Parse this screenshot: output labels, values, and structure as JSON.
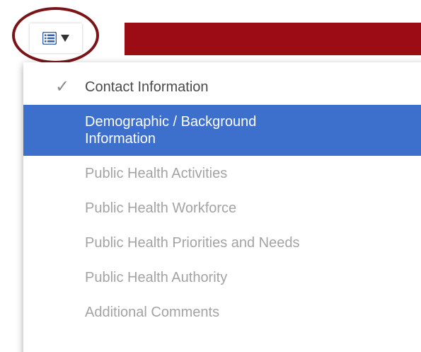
{
  "toolbar": {
    "toc_icon": "list-icon",
    "caret_icon": "caret-down-icon"
  },
  "colors": {
    "header_bar": "#9b0c14",
    "highlight_ring": "#7a1419",
    "active_item_bg": "#3d6fcc",
    "active_item_text": "#ffffff",
    "visited_item_text": "#4a4a4a",
    "inactive_item_text": "#a3a3a3"
  },
  "menu": {
    "items": [
      {
        "label": "Contact Information",
        "state": "visited",
        "icon": "checkmark-icon",
        "icon_glyph": "✓"
      },
      {
        "label": "Demographic / Background Information",
        "state": "active"
      },
      {
        "label": "Public Health Activities",
        "state": "disabled"
      },
      {
        "label": "Public Health Workforce",
        "state": "disabled"
      },
      {
        "label": "Public Health Priorities and Needs",
        "state": "disabled"
      },
      {
        "label": "Public Health Authority",
        "state": "disabled"
      },
      {
        "label": "Additional Comments",
        "state": "disabled"
      }
    ]
  }
}
